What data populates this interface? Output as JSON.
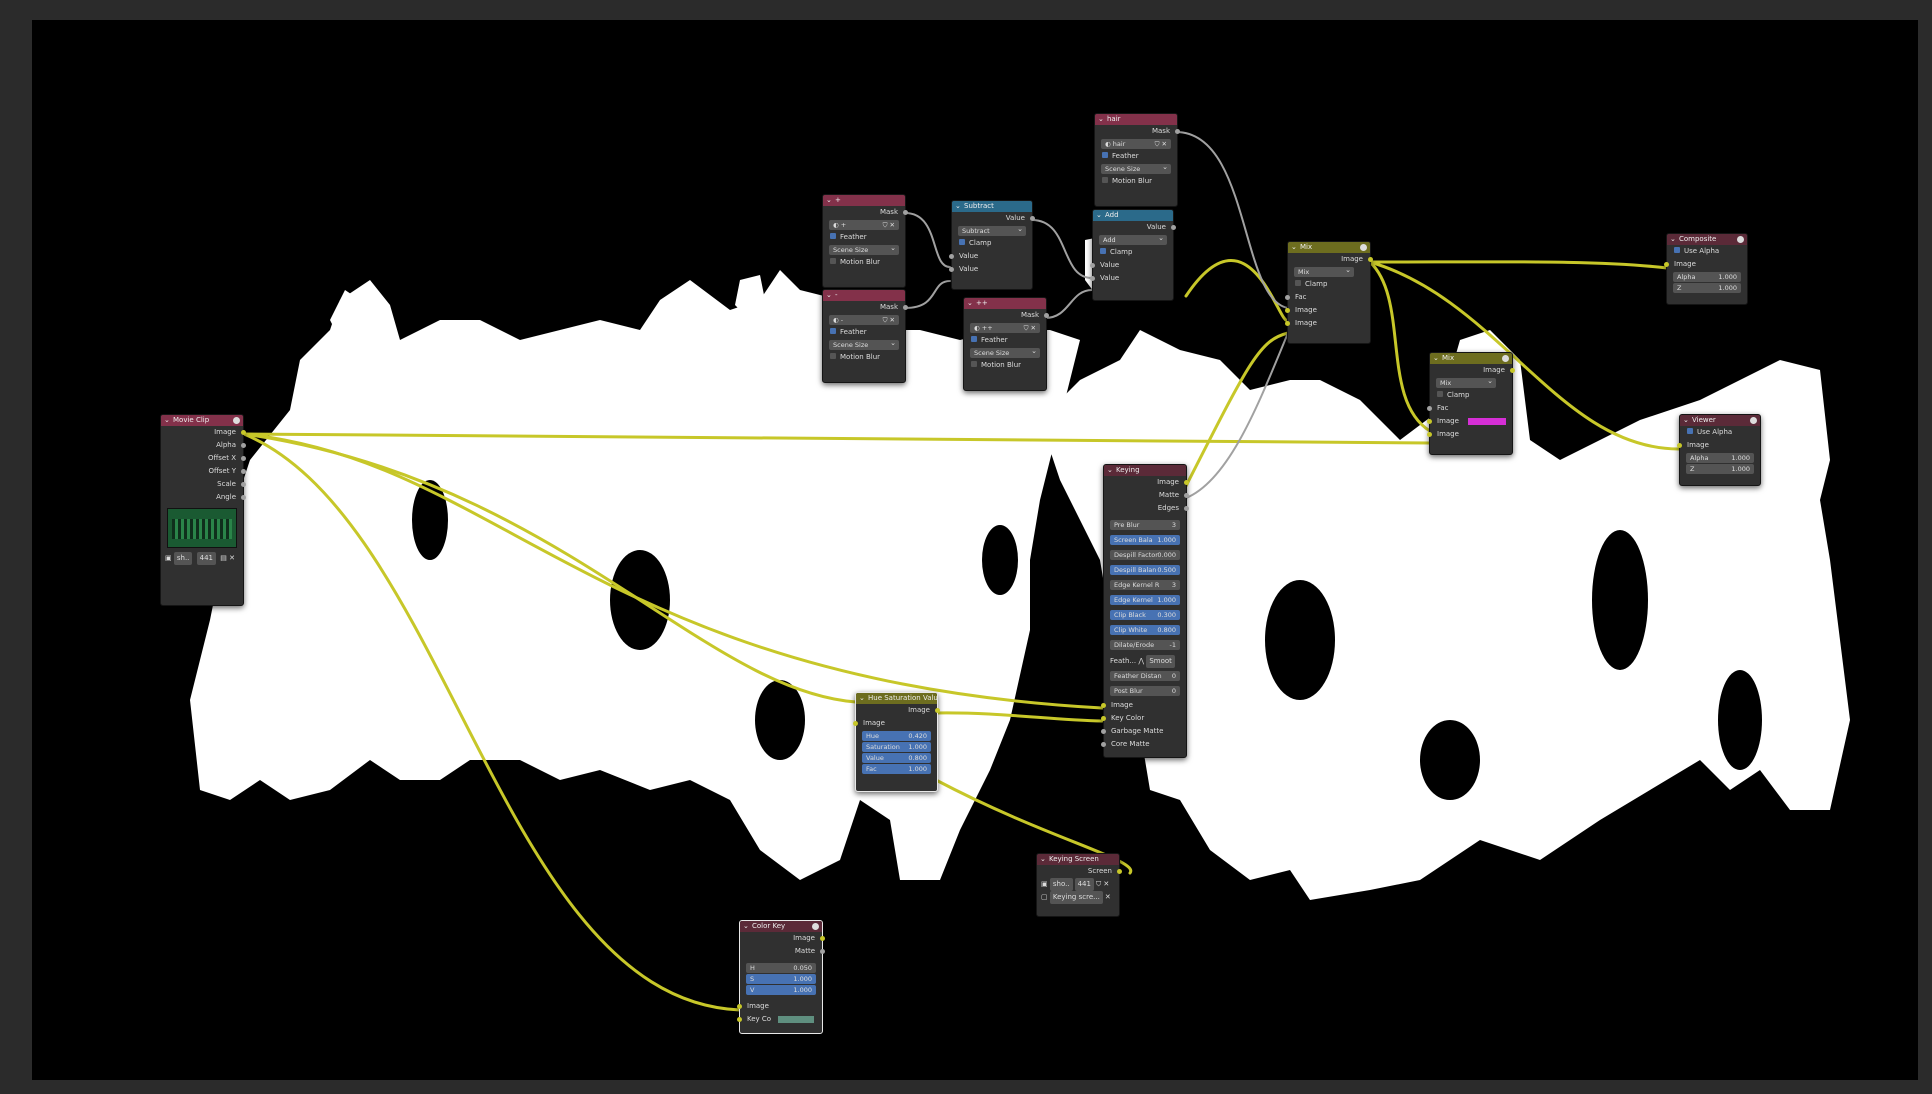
{
  "nodes": {
    "movie_clip": {
      "title": "Movie Clip",
      "outputs": [
        "Image",
        "Alpha",
        "Offset X",
        "Offset Y",
        "Scale",
        "Angle"
      ],
      "clip_name": "sh..",
      "clip_frames": "441"
    },
    "mask_plus": {
      "title": "+",
      "output": "Mask",
      "mask_name": "+",
      "feather_label": "Feather",
      "size_option": "Scene Size",
      "motion_blur_label": "Motion Blur"
    },
    "mask_minus": {
      "title": "-",
      "output": "Mask",
      "mask_name": "-",
      "feather_label": "Feather",
      "size_option": "Scene Size",
      "motion_blur_label": "Motion Blur"
    },
    "subtract": {
      "title": "Subtract",
      "output": "Value",
      "operation": "Subtract",
      "clamp_label": "Clamp",
      "inputs": [
        "Value",
        "Value"
      ]
    },
    "mask_plusplus": {
      "title": "++",
      "output": "Mask",
      "mask_name": "++",
      "feather_label": "Feather",
      "size_option": "Scene Size",
      "motion_blur_label": "Motion Blur"
    },
    "mask_hair": {
      "title": "hair",
      "output": "Mask",
      "mask_name": "hair",
      "feather_label": "Feather",
      "size_option": "Scene Size",
      "motion_blur_label": "Motion Blur"
    },
    "add": {
      "title": "Add",
      "output": "Value",
      "operation": "Add",
      "clamp_label": "Clamp",
      "inputs": [
        "Value",
        "Value"
      ]
    },
    "mix_top": {
      "title": "Mix",
      "output": "Image",
      "blend": "Mix",
      "clamp_label": "Clamp",
      "inputs": [
        "Fac",
        "Image",
        "Image"
      ]
    },
    "composite": {
      "title": "Composite",
      "use_alpha_label": "Use Alpha",
      "input": "Image",
      "alpha_label": "Alpha",
      "alpha_value": "1.000",
      "z_label": "Z",
      "z_value": "1.000"
    },
    "mix_right": {
      "title": "Mix",
      "output": "Image",
      "blend": "Mix",
      "clamp_label": "Clamp",
      "inputs": [
        "Fac",
        "Image",
        "Image"
      ],
      "image_color": "#d62fd6"
    },
    "viewer": {
      "title": "Viewer",
      "use_alpha_label": "Use Alpha",
      "input": "Image",
      "alpha_label": "Alpha",
      "alpha_value": "1.000",
      "z_label": "Z",
      "z_value": "1.000"
    },
    "keying": {
      "title": "Keying",
      "outputs": [
        "Image",
        "Matte",
        "Edges"
      ],
      "fields": [
        {
          "label": "Pre Blur",
          "value": "3",
          "blue": false
        },
        {
          "label": "Screen Bala",
          "value": "1.000",
          "blue": true
        },
        {
          "label": "Despill Factor",
          "value": "0.000",
          "blue": false
        },
        {
          "label": "Despill Balan",
          "value": "0.500",
          "blue": true
        },
        {
          "label": "Edge Kernel R",
          "value": "3",
          "blue": false
        },
        {
          "label": "Edge Kernel",
          "value": "1.000",
          "blue": true
        },
        {
          "label": "Clip Black",
          "value": "0.300",
          "blue": true
        },
        {
          "label": "Clip White",
          "value": "0.800",
          "blue": true
        },
        {
          "label": "Dilate/Erode",
          "value": "-1",
          "blue": false
        }
      ],
      "falloff_label": "Feath...",
      "falloff_value": "Smoot",
      "fields2": [
        {
          "label": "Feather Distan",
          "value": "0"
        },
        {
          "label": "Post Blur",
          "value": "0"
        }
      ],
      "inputs": [
        "Image",
        "Key Color",
        "Garbage Matte",
        "Core Matte"
      ]
    },
    "hsv": {
      "title": "Hue Saturation Value",
      "output": "Image",
      "input": "Image",
      "fields": [
        {
          "label": "Hue",
          "value": "0.420"
        },
        {
          "label": "Saturation",
          "value": "1.000"
        },
        {
          "label": "Value",
          "value": "0.800"
        },
        {
          "label": "Fac",
          "value": "1.000"
        }
      ]
    },
    "keying_screen": {
      "title": "Keying Screen",
      "output": "Screen",
      "clip_name": "sho..",
      "clip_frames": "441",
      "tracking_object": "Keying scre..."
    },
    "color_key": {
      "title": "Color Key",
      "outputs": [
        "Image",
        "Matte"
      ],
      "fields": [
        {
          "label": "H",
          "value": "0.050"
        },
        {
          "label": "S",
          "value": "1.000"
        },
        {
          "label": "V",
          "value": "1.000"
        }
      ],
      "inputs": [
        "Image",
        "Key Co"
      ],
      "key_color": "#5f8f7f"
    }
  },
  "colors": {
    "backdrop": "#000000",
    "editor_bg": "#2b2b2b",
    "wire_image": "#c7c729",
    "mask_header": "#83314a",
    "math_header": "#2b6a8a",
    "mix_header": "#6d6d1f"
  }
}
